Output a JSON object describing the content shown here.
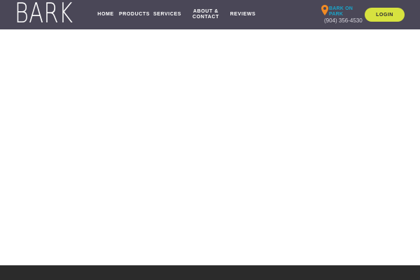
{
  "header": {
    "logo_text": "BARK",
    "nav": {
      "home": "HOME",
      "products": "PRODUCTS",
      "services": "SERVICES",
      "about_contact": "ABOUT & CONTACT",
      "reviews": "REVIEWS"
    },
    "location": {
      "icon": "map-pin-icon",
      "name": "BARK ON PARK",
      "phone": "(904) 356-4530"
    },
    "login_label": "LOGIN"
  },
  "colors": {
    "header_bg": "#4a4757",
    "accent_button": "#d7e23f",
    "location_text": "#1aa5c9",
    "pin_icon": "#f08a24",
    "footer_bg": "#2b2b2b"
  }
}
